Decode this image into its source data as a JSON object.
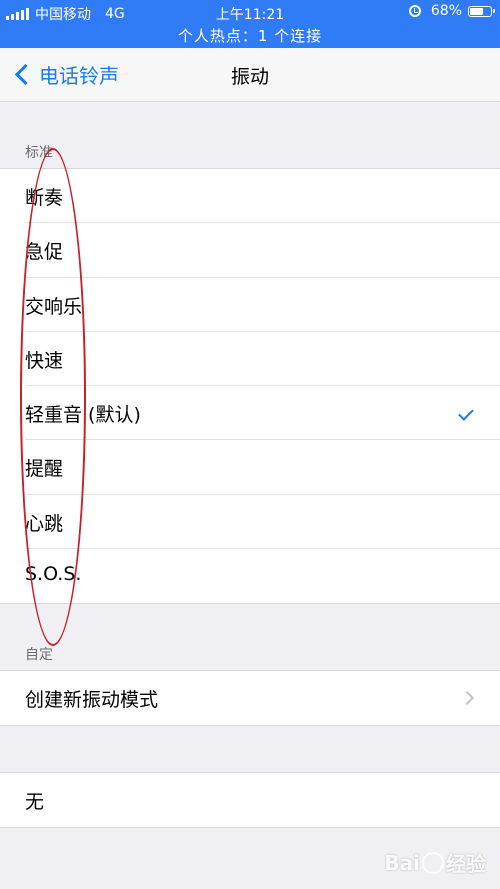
{
  "status_bar": {
    "carrier": "中国移动",
    "network": "4G",
    "time": "上午11:21",
    "battery_percent": "68%",
    "battery_level": 0.68,
    "hotspot_text": "个人热点：1 个连接",
    "icons": [
      "signal-icon",
      "alarm-icon",
      "battery-icon"
    ]
  },
  "nav": {
    "back_label": "电话铃声",
    "title": "振动"
  },
  "sections": {
    "standard": {
      "header": "标准",
      "items": [
        "断奏",
        "急促",
        "交响乐",
        "快速",
        "轻重音 (默认)",
        "提醒",
        "心跳",
        "S.O.S."
      ],
      "selected_index": 4
    },
    "custom": {
      "header": "自定",
      "create_label": "创建新振动模式"
    },
    "none_label": "无"
  },
  "watermark": {
    "left_text": "Bai",
    "right_text": "经验"
  },
  "colors": {
    "status_bar_bg": "#2f7cf6",
    "accent": "#1a7af6",
    "background": "#efeff4",
    "annotation": "#c8202a"
  }
}
